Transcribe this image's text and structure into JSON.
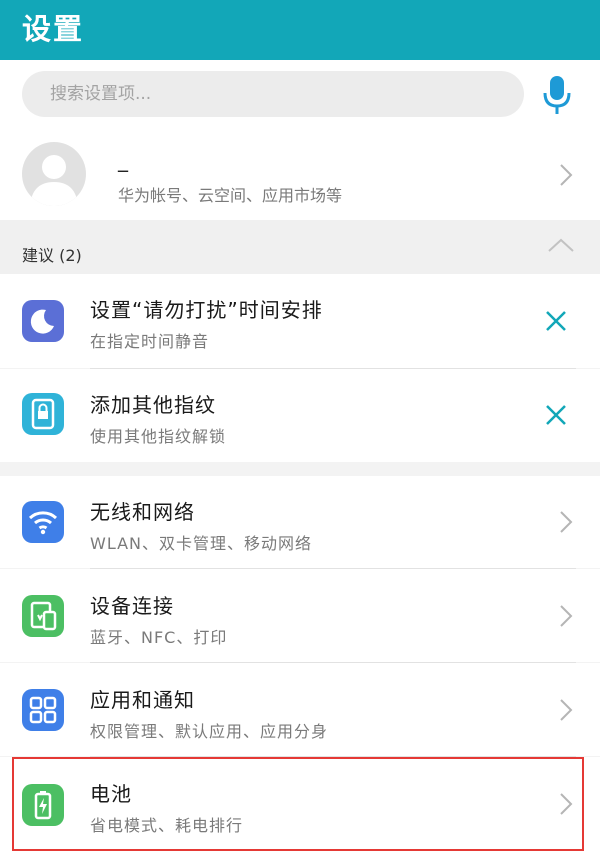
{
  "header": {
    "title": "设置"
  },
  "search": {
    "placeholder": "搜索设置项..."
  },
  "account": {
    "name": "_",
    "subtitle": "华为帐号、云空间、应用市场等"
  },
  "suggestions": {
    "label": "建议 (2)",
    "items": [
      {
        "title": "设置“请勿打扰”时间安排",
        "subtitle": "在指定时间静音",
        "icon": "moon-icon",
        "color": "#5b6fd6"
      },
      {
        "title": "添加其他指纹",
        "subtitle": "使用其他指纹解锁",
        "icon": "fingerprint-lock-icon",
        "color": "#2fb3d8"
      }
    ]
  },
  "settings": {
    "items": [
      {
        "title": "无线和网络",
        "subtitle": "WLAN、双卡管理、移动网络",
        "icon": "wifi-icon",
        "color": "#3f7fe8"
      },
      {
        "title": "设备连接",
        "subtitle": "蓝牙、NFC、打印",
        "icon": "device-connection-icon",
        "color": "#4cbf63"
      },
      {
        "title": "应用和通知",
        "subtitle": "权限管理、默认应用、应用分身",
        "icon": "apps-grid-icon",
        "color": "#3f7fe8"
      },
      {
        "title": "电池",
        "subtitle": "省电模式、耗电排行",
        "icon": "battery-icon",
        "color": "#4cbf63"
      }
    ]
  },
  "colors": {
    "accent": "#12a7b8",
    "highlight": "#e53935"
  }
}
